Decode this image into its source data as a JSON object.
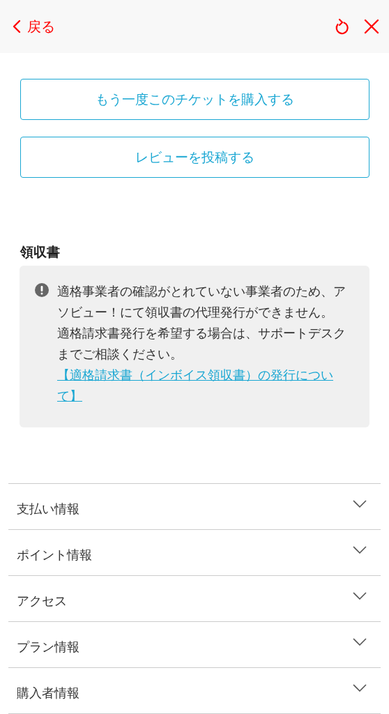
{
  "header": {
    "back_label": "戻る"
  },
  "actions": [
    {
      "label": "もう一度このチケットを購入する"
    },
    {
      "label": "レビューを投稿する"
    }
  ],
  "receipt": {
    "heading": "領収書",
    "notice": {
      "paragraphs": [
        "適格事業者の確認がとれていない事業者のため、アソビュー！にて領収書の代理発行ができません。",
        "適格請求書発行を希望する場合は、サポートデスクまでご相談ください。"
      ],
      "link": "【適格請求書（インボイス領収書）の発行について】"
    }
  },
  "sections": [
    {
      "label": "支払い情報",
      "expanded": false
    },
    {
      "label": "ポイント情報",
      "expanded": false
    },
    {
      "label": "アクセス",
      "expanded": false
    },
    {
      "label": "プラン情報",
      "expanded": false
    },
    {
      "label": "購入者情報",
      "expanded": false
    }
  ]
}
